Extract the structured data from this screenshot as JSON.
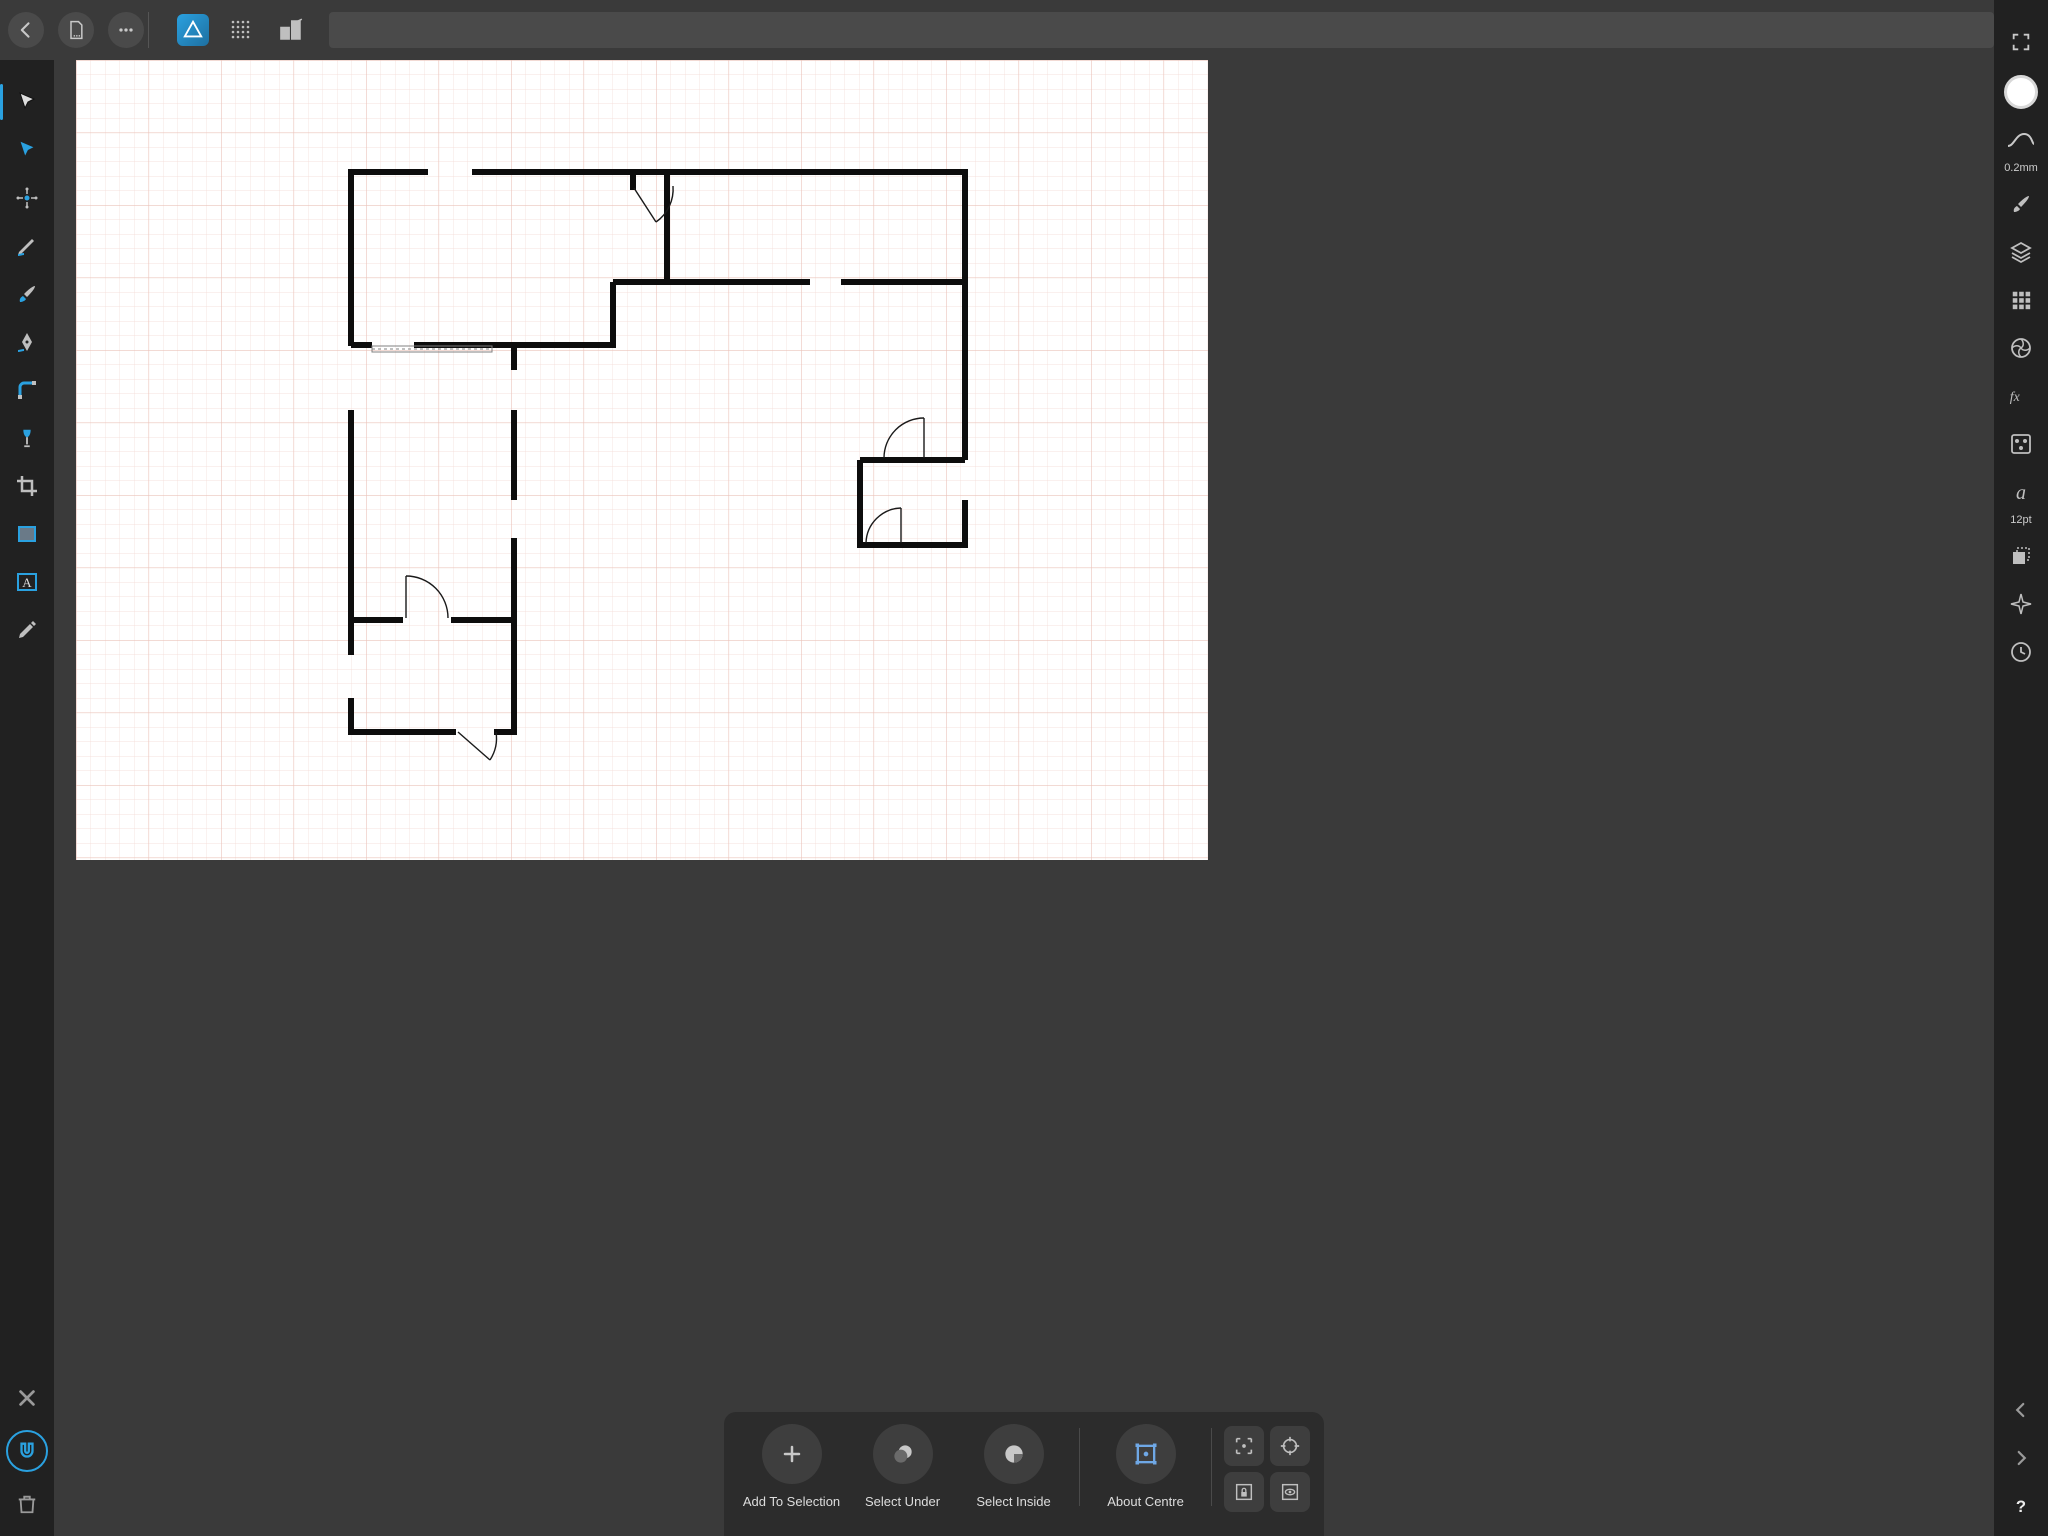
{
  "right_panel": {
    "stroke_width_label": "0.2mm",
    "font_size_label": "12pt"
  },
  "context_bar": {
    "items": [
      {
        "label": "Add To Selection"
      },
      {
        "label": "Select Under"
      },
      {
        "label": "Select Inside"
      },
      {
        "label": "About Centre"
      }
    ]
  }
}
